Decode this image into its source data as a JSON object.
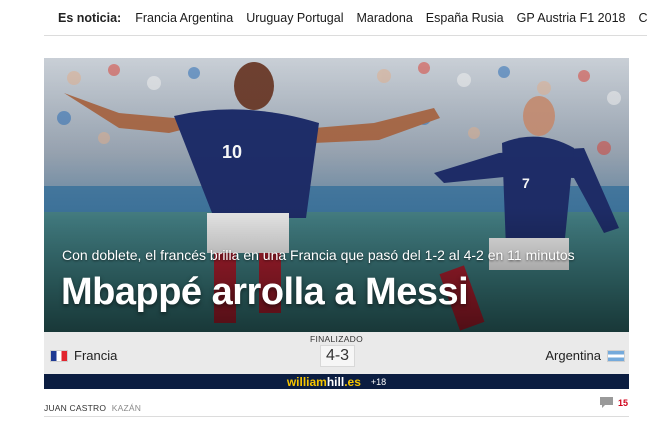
{
  "trending": {
    "label": "Es noticia:",
    "links": [
      "Francia Argentina",
      "Uruguay Portugal",
      "Maradona",
      "España Rusia",
      "GP Austria F1 2018",
      "Cuadro fi"
    ]
  },
  "article": {
    "subtitle": "Con doblete, el francés brilla en una Francia que pasó del 1-2 al 4-2 en 11 minutos",
    "headline": "Mbappé arrolla a Messi"
  },
  "scoreboard": {
    "status": "FINALIZADO",
    "score": "4-3",
    "home": {
      "name": "Francia",
      "flag": "france-flag-icon"
    },
    "away": {
      "name": "Argentina",
      "flag": "argentina-flag-icon"
    }
  },
  "sponsor": {
    "brand_a": "william",
    "brand_dot": "hill",
    "brand_b": ".es",
    "age": "+18"
  },
  "byline": {
    "author": "JUAN CASTRO",
    "city": "KAZÁN"
  },
  "comments": {
    "icon": "comment-icon",
    "count": "15"
  },
  "colors": {
    "sponsor_bg": "#0b1d41",
    "sponsor_brand": "#f5c400",
    "comment_count": "#d0021b"
  }
}
